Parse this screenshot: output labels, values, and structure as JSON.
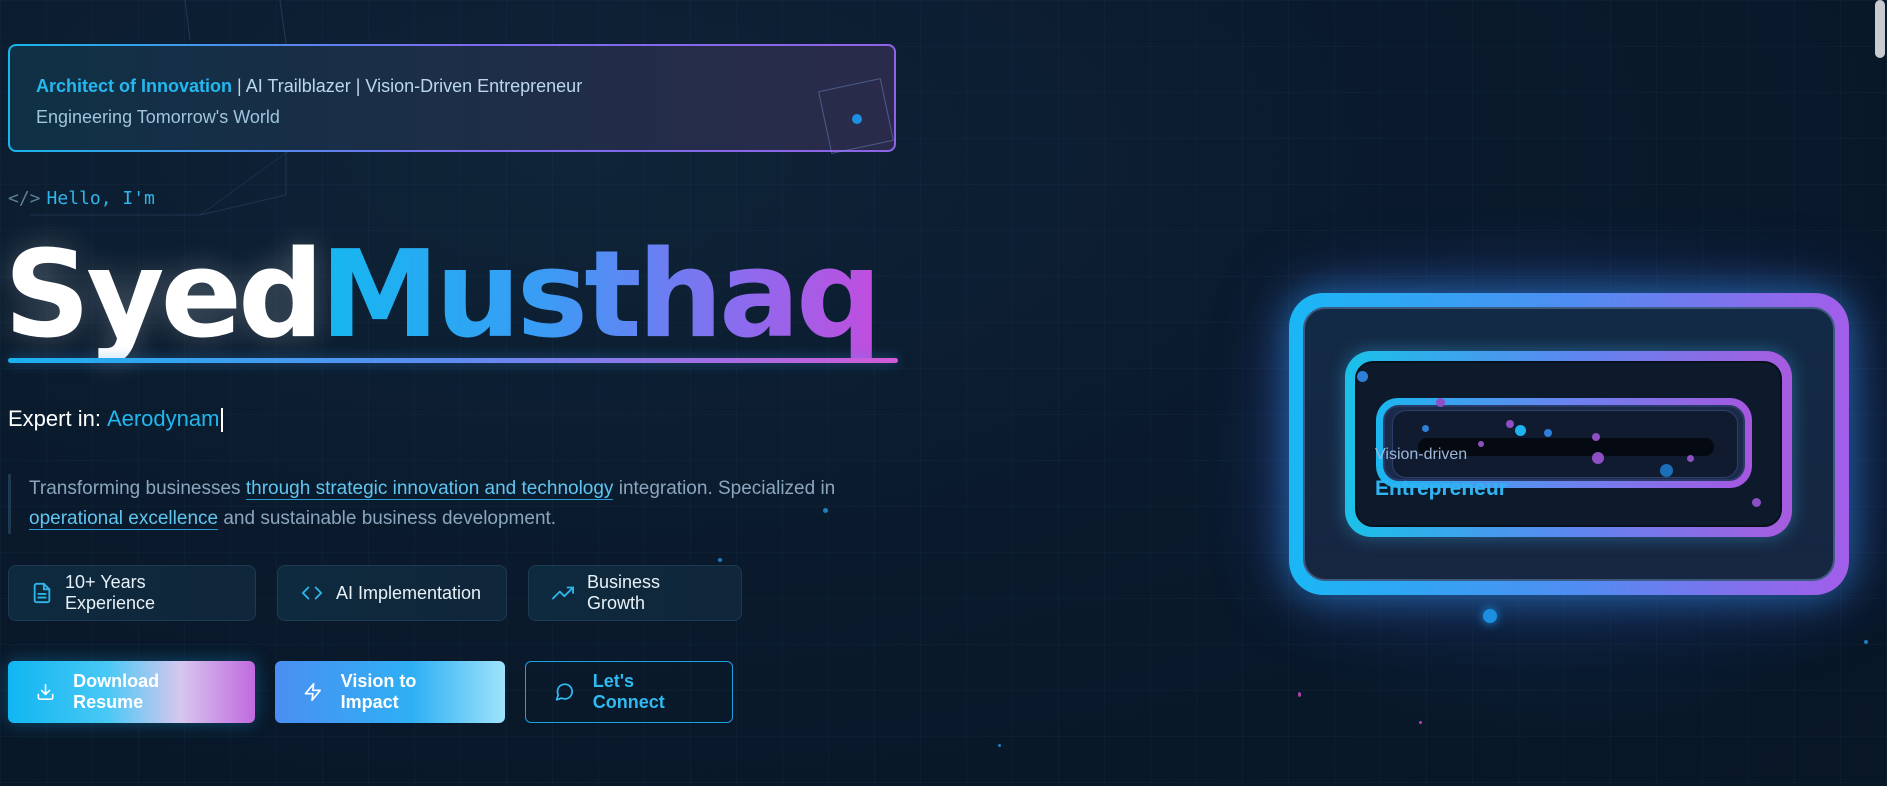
{
  "banner": {
    "highlight": "Architect of Innovation",
    "rest": " | AI Trailblazer | Vision-Driven Entrepreneur",
    "subtitle": "Engineering Tomorrow's World"
  },
  "hero": {
    "code_tag": "</>",
    "greeting": "Hello, I'm",
    "first_name": "Syed",
    "last_name": "Musthaq"
  },
  "expert": {
    "label": "Expert in:",
    "value": "Aerodynam"
  },
  "description": {
    "part1": "Transforming businesses ",
    "link1": "through strategic innovation and technology",
    "part2": " integration. Specialized in ",
    "link2": "operational excellence",
    "part3": " and sustainable business development."
  },
  "chips": [
    {
      "label": "10+ Years Experience",
      "icon": "document-icon"
    },
    {
      "label": "AI Implementation",
      "icon": "code-icon"
    },
    {
      "label": "Business Growth",
      "icon": "trending-up-icon"
    }
  ],
  "buttons": {
    "download": "Download Resume",
    "vision": "Vision to Impact",
    "connect": "Let's Connect"
  },
  "art": {
    "small_label": "Vision-driven",
    "big_label": "Entrepreneur"
  },
  "colors": {
    "accent_cyan": "#21b7f0",
    "accent_purple": "#a25de9",
    "background": "#0a1a2c"
  }
}
